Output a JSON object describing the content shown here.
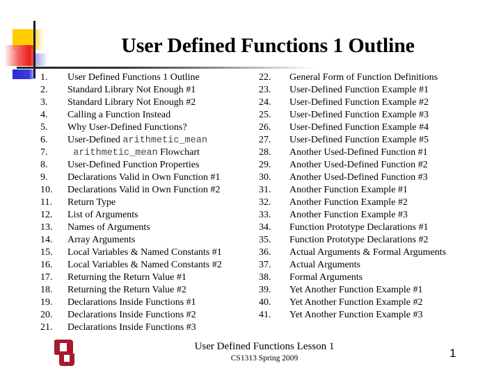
{
  "slide": {
    "title": "User Defined Functions 1 Outline",
    "left_items": [
      {
        "num": "1.",
        "text": "User Defined Functions 1 Outline"
      },
      {
        "num": "2.",
        "text": "Standard Library Not Enough #1"
      },
      {
        "num": "3.",
        "text": "Standard Library Not Enough #2"
      },
      {
        "num": "4.",
        "text": "Calling a Function Instead"
      },
      {
        "num": "5.",
        "text": "Why User-Defined Functions?"
      },
      {
        "num": "6.",
        "text": "User-Defined ",
        "code": "arithmetic_mean"
      },
      {
        "num": "7.",
        "code": " arithmetic_mean",
        "text": " Flowchart"
      },
      {
        "num": "8.",
        "text": "User-Defined Function Properties"
      },
      {
        "num": "9.",
        "text": "Declarations Valid in Own Function #1"
      },
      {
        "num": "10.",
        "text": "Declarations Valid in Own Function #2"
      },
      {
        "num": "11.",
        "text": "Return Type"
      },
      {
        "num": "12.",
        "text": "List of Arguments"
      },
      {
        "num": "13.",
        "text": "Names of Arguments"
      },
      {
        "num": "14.",
        "text": "Array Arguments"
      },
      {
        "num": "15.",
        "text": "Local Variables & Named Constants #1"
      },
      {
        "num": "16.",
        "text": "Local Variables & Named Constants #2"
      },
      {
        "num": "17.",
        "text": "Returning the Return Value #1"
      },
      {
        "num": "18.",
        "text": "Returning the Return Value #2"
      },
      {
        "num": "19.",
        "text": "Declarations Inside Functions #1"
      },
      {
        "num": "20.",
        "text": "Declarations Inside Functions #2"
      },
      {
        "num": "21.",
        "text": "Declarations Inside Functions #3"
      }
    ],
    "right_items": [
      {
        "num": "22.",
        "text": "General Form of Function Definitions"
      },
      {
        "num": "23.",
        "text": "User-Defined Function Example #1"
      },
      {
        "num": "24.",
        "text": "User-Defined Function Example #2"
      },
      {
        "num": "25.",
        "text": "User-Defined Function Example #3"
      },
      {
        "num": "26.",
        "text": "User-Defined Function Example #4"
      },
      {
        "num": "27.",
        "text": "User-Defined Function Example #5"
      },
      {
        "num": "28.",
        "text": "Another Used-Defined Function #1"
      },
      {
        "num": "29.",
        "text": "Another Used-Defined Function #2"
      },
      {
        "num": "30.",
        "text": "Another Used-Defined Function #3"
      },
      {
        "num": "31.",
        "text": "Another Function Example #1"
      },
      {
        "num": "32.",
        "text": "Another Function Example #2"
      },
      {
        "num": "33.",
        "text": "Another Function Example #3"
      },
      {
        "num": "34.",
        "text": "Function Prototype Declarations #1"
      },
      {
        "num": "35.",
        "text": "Function Prototype Declarations #2"
      },
      {
        "num": "36.",
        "text": "Actual Arguments & Formal Arguments"
      },
      {
        "num": "37.",
        "text": "Actual Arguments"
      },
      {
        "num": "38.",
        "text": "Formal Arguments"
      },
      {
        "num": "39.",
        "text": "Yet Another Function Example #1"
      },
      {
        "num": "40.",
        "text": "Yet Another Function Example #2"
      },
      {
        "num": "41.",
        "text": "Yet Another Function Example #3"
      }
    ]
  },
  "footer": {
    "logo_icon": "ou-logo-icon",
    "logo_color": "#a6192e",
    "title": "User Defined Functions Lesson 1",
    "subtitle": "CS1313 Spring 2009",
    "slide_number": "1"
  },
  "decor": {
    "colors": {
      "yellow": "#ffcc00",
      "red": "#ee1c1c",
      "blue": "#2b2bd6",
      "line": "#1a1a2a"
    }
  }
}
